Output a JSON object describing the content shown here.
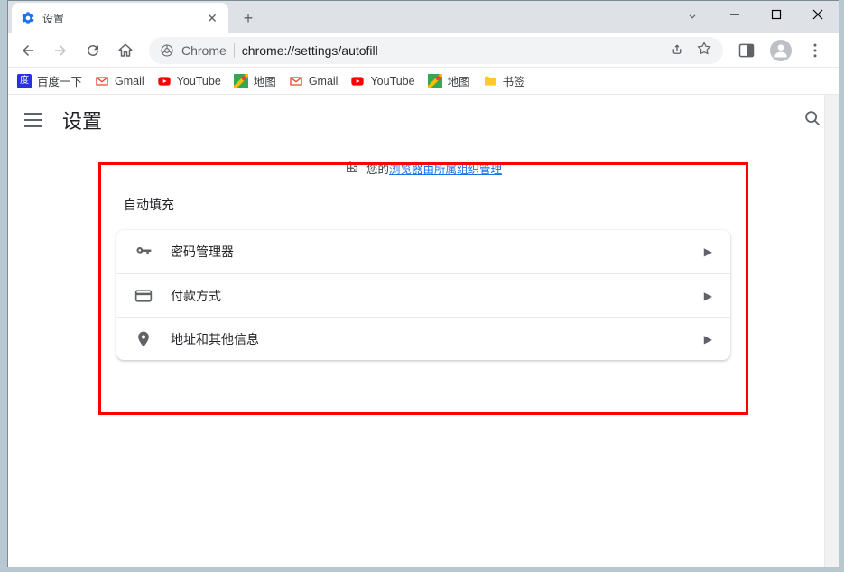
{
  "window": {
    "tab_title": "设置"
  },
  "omnibox": {
    "prefix": "Chrome",
    "url": "chrome://settings/autofill"
  },
  "bookmarks": [
    {
      "label": "百度一下",
      "icon": "baidu"
    },
    {
      "label": "Gmail",
      "icon": "gmail"
    },
    {
      "label": "YouTube",
      "icon": "youtube"
    },
    {
      "label": "地图",
      "icon": "maps"
    },
    {
      "label": "Gmail",
      "icon": "gmail"
    },
    {
      "label": "YouTube",
      "icon": "youtube"
    },
    {
      "label": "地图",
      "icon": "maps"
    },
    {
      "label": "书签",
      "icon": "folder"
    }
  ],
  "settings": {
    "page_title": "设置",
    "managed_prefix": "您的",
    "managed_link": "浏览器由所属组织管理",
    "section_title": "自动填充",
    "rows": [
      {
        "icon": "key",
        "label": "密码管理器"
      },
      {
        "icon": "card",
        "label": "付款方式"
      },
      {
        "icon": "pin",
        "label": "地址和其他信息"
      }
    ]
  }
}
